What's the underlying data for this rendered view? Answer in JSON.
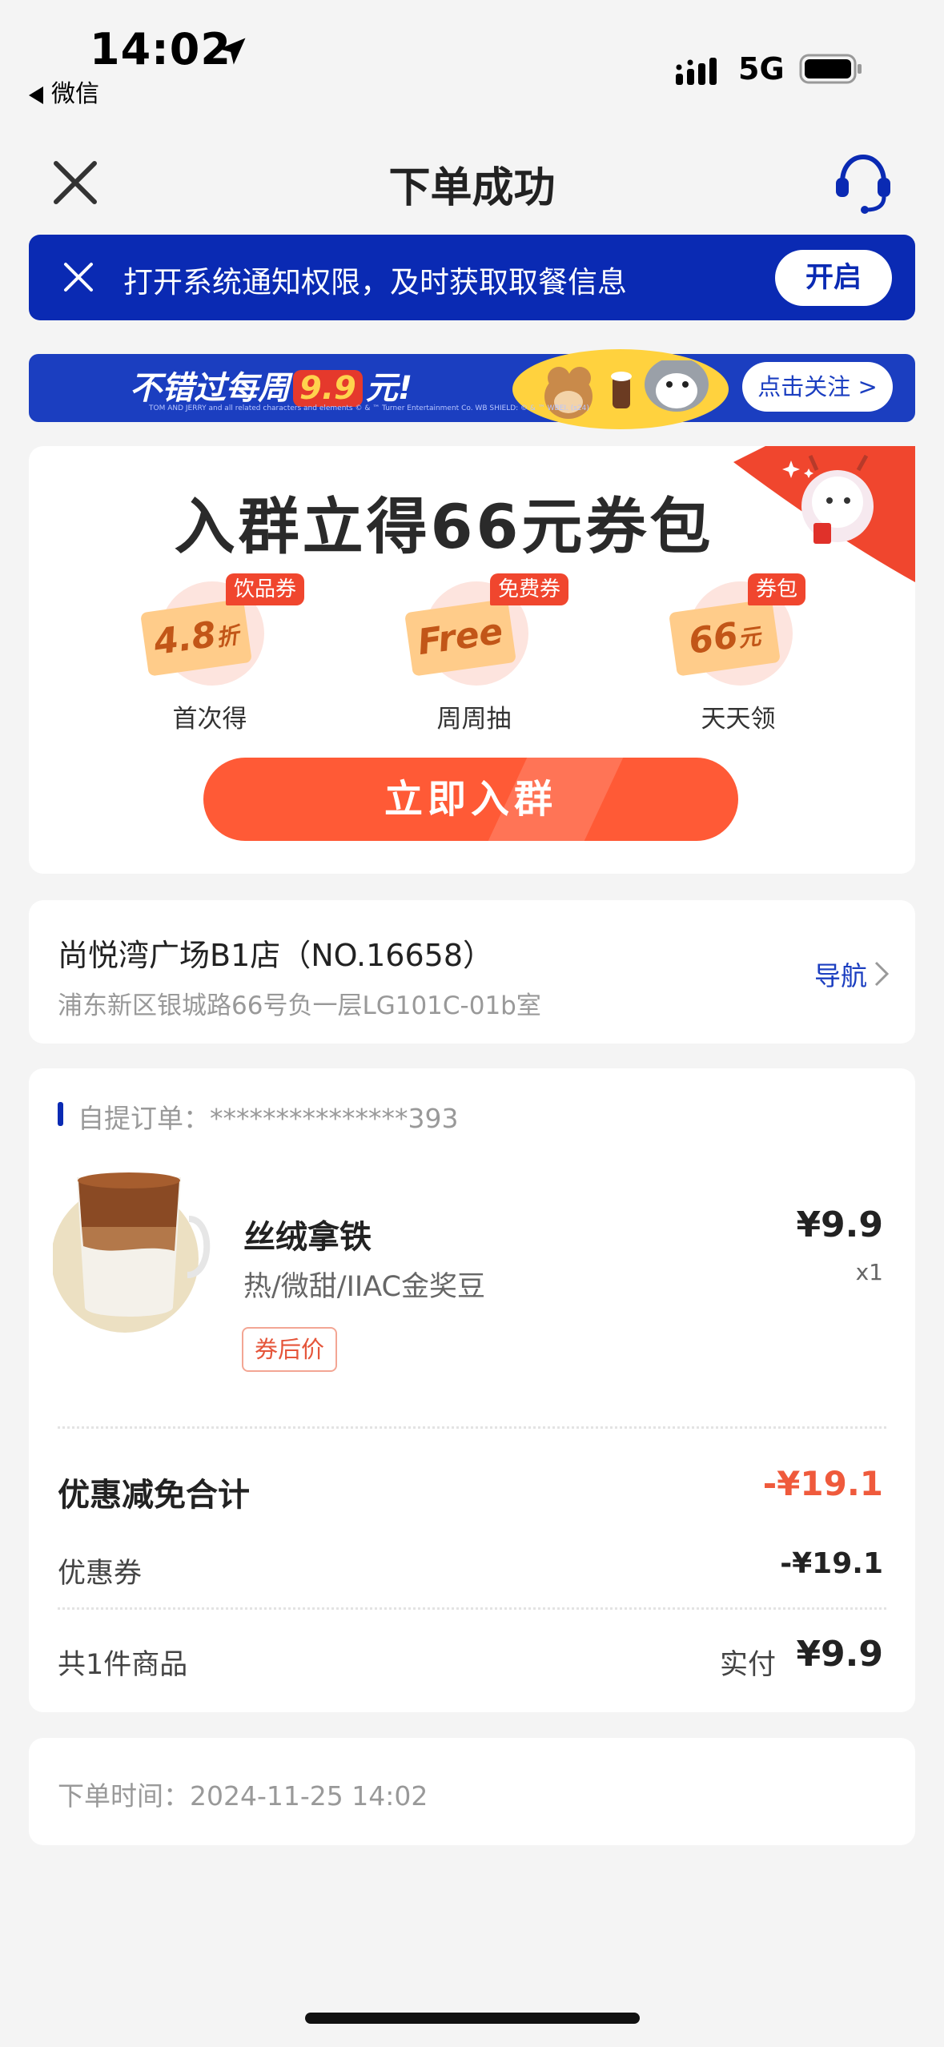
{
  "status_bar": {
    "time": "14:02",
    "back_app": "微信",
    "network": "5G"
  },
  "header": {
    "title": "下单成功"
  },
  "notify_banner": {
    "text": "打开系统通知权限，及时获取取餐信息",
    "button": "开启"
  },
  "promo_banner": {
    "text_before": "不错过每周",
    "highlight": "9.9",
    "text_after": "元!",
    "fine_print": "TOM AND JERRY and all related characters and elements © & ™ Turner Entertainment Co. WB SHIELD: © & ™ WBEI. (s24)",
    "follow_button": "点击关注"
  },
  "group_card": {
    "title": "入群立得66元券包",
    "coupons": [
      {
        "tag": "饮品券",
        "face_value": "4.8",
        "face_unit": "折",
        "label": "首次得"
      },
      {
        "tag": "免费券",
        "face_value": "Free",
        "face_unit": "",
        "label": "周周抽"
      },
      {
        "tag": "券包",
        "face_value": "66",
        "face_unit": "元",
        "label": "天天领"
      }
    ],
    "join_button": "立即入群"
  },
  "store": {
    "name": "尚悦湾广场B1店（NO.16658）",
    "address": "浦东新区银城路66号负一层LG101C-01b室",
    "nav_label": "导航"
  },
  "order": {
    "label": "自提订单：***************393",
    "item": {
      "name": "丝绒拿铁",
      "spec": "热/微甜/IIAC金奖豆",
      "tag": "券后价",
      "price": "¥9.9",
      "qty": "x1"
    },
    "discount_total_label": "优惠减免合计",
    "discount_total_value": "-¥19.1",
    "coupon_label": "优惠券",
    "coupon_value": "-¥19.1",
    "count_label": "共1件商品",
    "paid_label": "实付",
    "paid_value": "¥9.9"
  },
  "order_time": {
    "text": "下单时间：2024-11-25 14:02"
  },
  "colors": {
    "brand_blue": "#0a2ab3",
    "accent_orange": "#ff5a36",
    "discount_red": "#ef5a3c",
    "background": "#f4f4f4"
  }
}
